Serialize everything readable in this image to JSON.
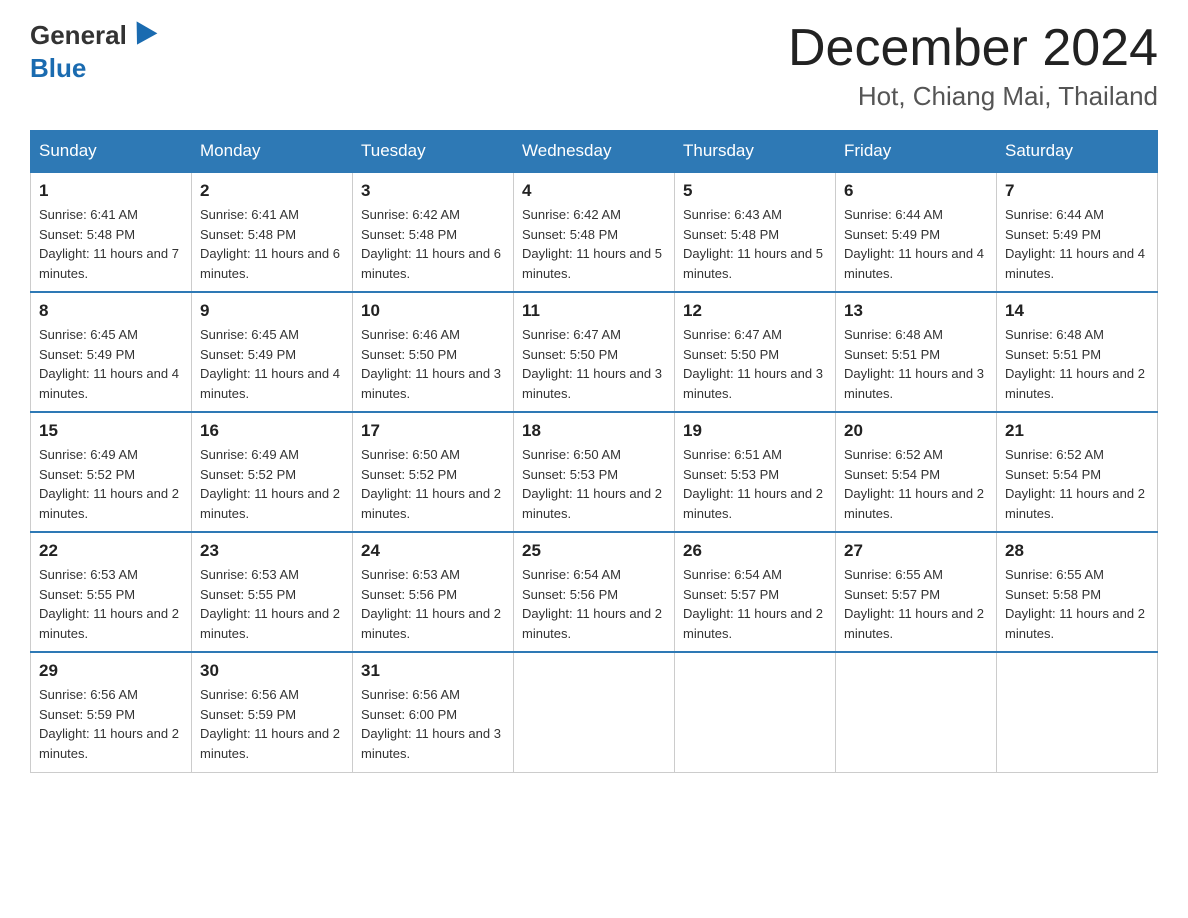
{
  "header": {
    "logo_general": "General",
    "logo_blue": "Blue",
    "month_title": "December 2024",
    "location": "Hot, Chiang Mai, Thailand"
  },
  "calendar": {
    "days_of_week": [
      "Sunday",
      "Monday",
      "Tuesday",
      "Wednesday",
      "Thursday",
      "Friday",
      "Saturday"
    ],
    "weeks": [
      [
        {
          "day": "1",
          "sunrise": "6:41 AM",
          "sunset": "5:48 PM",
          "daylight": "11 hours and 7 minutes."
        },
        {
          "day": "2",
          "sunrise": "6:41 AM",
          "sunset": "5:48 PM",
          "daylight": "11 hours and 6 minutes."
        },
        {
          "day": "3",
          "sunrise": "6:42 AM",
          "sunset": "5:48 PM",
          "daylight": "11 hours and 6 minutes."
        },
        {
          "day": "4",
          "sunrise": "6:42 AM",
          "sunset": "5:48 PM",
          "daylight": "11 hours and 5 minutes."
        },
        {
          "day": "5",
          "sunrise": "6:43 AM",
          "sunset": "5:48 PM",
          "daylight": "11 hours and 5 minutes."
        },
        {
          "day": "6",
          "sunrise": "6:44 AM",
          "sunset": "5:49 PM",
          "daylight": "11 hours and 4 minutes."
        },
        {
          "day": "7",
          "sunrise": "6:44 AM",
          "sunset": "5:49 PM",
          "daylight": "11 hours and 4 minutes."
        }
      ],
      [
        {
          "day": "8",
          "sunrise": "6:45 AM",
          "sunset": "5:49 PM",
          "daylight": "11 hours and 4 minutes."
        },
        {
          "day": "9",
          "sunrise": "6:45 AM",
          "sunset": "5:49 PM",
          "daylight": "11 hours and 4 minutes."
        },
        {
          "day": "10",
          "sunrise": "6:46 AM",
          "sunset": "5:50 PM",
          "daylight": "11 hours and 3 minutes."
        },
        {
          "day": "11",
          "sunrise": "6:47 AM",
          "sunset": "5:50 PM",
          "daylight": "11 hours and 3 minutes."
        },
        {
          "day": "12",
          "sunrise": "6:47 AM",
          "sunset": "5:50 PM",
          "daylight": "11 hours and 3 minutes."
        },
        {
          "day": "13",
          "sunrise": "6:48 AM",
          "sunset": "5:51 PM",
          "daylight": "11 hours and 3 minutes."
        },
        {
          "day": "14",
          "sunrise": "6:48 AM",
          "sunset": "5:51 PM",
          "daylight": "11 hours and 2 minutes."
        }
      ],
      [
        {
          "day": "15",
          "sunrise": "6:49 AM",
          "sunset": "5:52 PM",
          "daylight": "11 hours and 2 minutes."
        },
        {
          "day": "16",
          "sunrise": "6:49 AM",
          "sunset": "5:52 PM",
          "daylight": "11 hours and 2 minutes."
        },
        {
          "day": "17",
          "sunrise": "6:50 AM",
          "sunset": "5:52 PM",
          "daylight": "11 hours and 2 minutes."
        },
        {
          "day": "18",
          "sunrise": "6:50 AM",
          "sunset": "5:53 PM",
          "daylight": "11 hours and 2 minutes."
        },
        {
          "day": "19",
          "sunrise": "6:51 AM",
          "sunset": "5:53 PM",
          "daylight": "11 hours and 2 minutes."
        },
        {
          "day": "20",
          "sunrise": "6:52 AM",
          "sunset": "5:54 PM",
          "daylight": "11 hours and 2 minutes."
        },
        {
          "day": "21",
          "sunrise": "6:52 AM",
          "sunset": "5:54 PM",
          "daylight": "11 hours and 2 minutes."
        }
      ],
      [
        {
          "day": "22",
          "sunrise": "6:53 AM",
          "sunset": "5:55 PM",
          "daylight": "11 hours and 2 minutes."
        },
        {
          "day": "23",
          "sunrise": "6:53 AM",
          "sunset": "5:55 PM",
          "daylight": "11 hours and 2 minutes."
        },
        {
          "day": "24",
          "sunrise": "6:53 AM",
          "sunset": "5:56 PM",
          "daylight": "11 hours and 2 minutes."
        },
        {
          "day": "25",
          "sunrise": "6:54 AM",
          "sunset": "5:56 PM",
          "daylight": "11 hours and 2 minutes."
        },
        {
          "day": "26",
          "sunrise": "6:54 AM",
          "sunset": "5:57 PM",
          "daylight": "11 hours and 2 minutes."
        },
        {
          "day": "27",
          "sunrise": "6:55 AM",
          "sunset": "5:57 PM",
          "daylight": "11 hours and 2 minutes."
        },
        {
          "day": "28",
          "sunrise": "6:55 AM",
          "sunset": "5:58 PM",
          "daylight": "11 hours and 2 minutes."
        }
      ],
      [
        {
          "day": "29",
          "sunrise": "6:56 AM",
          "sunset": "5:59 PM",
          "daylight": "11 hours and 2 minutes."
        },
        {
          "day": "30",
          "sunrise": "6:56 AM",
          "sunset": "5:59 PM",
          "daylight": "11 hours and 2 minutes."
        },
        {
          "day": "31",
          "sunrise": "6:56 AM",
          "sunset": "6:00 PM",
          "daylight": "11 hours and 3 minutes."
        },
        null,
        null,
        null,
        null
      ]
    ]
  }
}
